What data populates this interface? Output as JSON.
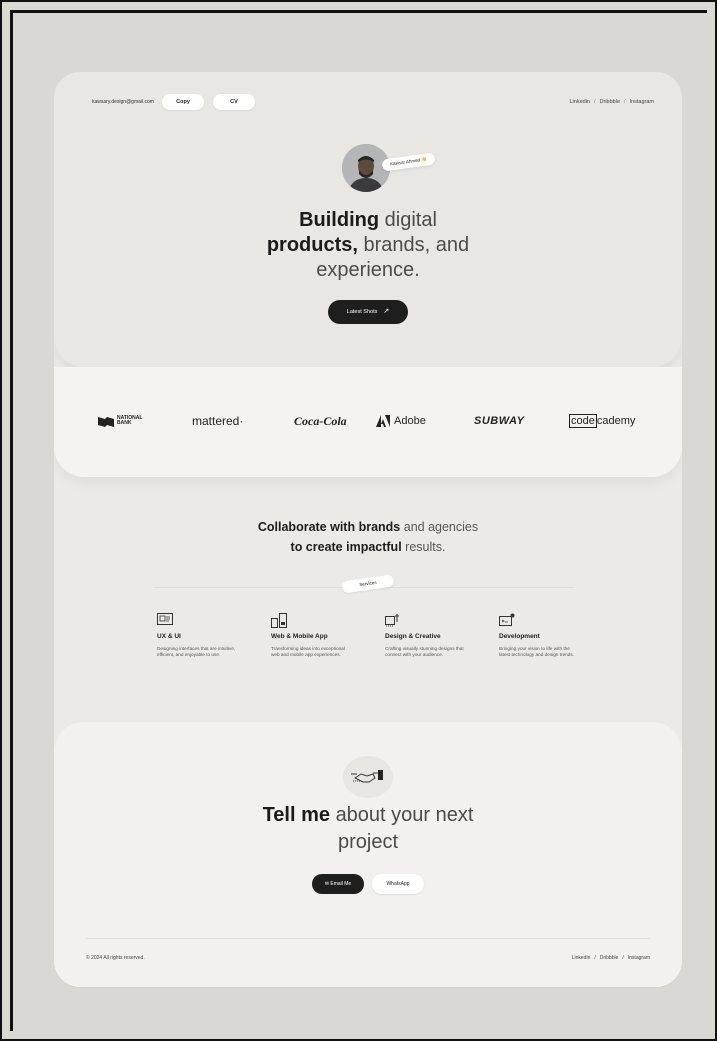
{
  "header": {
    "email": "kawsary.design@gmail.com",
    "copy_label": "Copy",
    "cv_label": "CV",
    "social": [
      "Linkedin",
      "Dribbble",
      "Instagram"
    ],
    "separator": "/"
  },
  "hero": {
    "name_tag": "Kawsar Ahmed 👋",
    "title_line1_bold": "Building",
    "title_line1_light": "digital",
    "title_line2_bold": "products,",
    "title_line2_light": "brands, and",
    "title_line3": "experience.",
    "cta_label": "Latest Shots",
    "cta_arrow": "↗"
  },
  "logos": {
    "national_bank_1": "NATIONAL",
    "national_bank_2": "BANK",
    "mattered": "mattered·",
    "cocacola": "Coca-Cola",
    "adobe": "Adobe",
    "subway": "SUBWAY",
    "codecademy_box": "code",
    "codecademy_rest": "cademy"
  },
  "services": {
    "headline_line1_bold": "Collaborate with brands",
    "headline_line1_light": "and agencies",
    "headline_line2_bold": "to create impactful",
    "headline_line2_light": "results.",
    "tag": "Services",
    "items": [
      {
        "title": "UX & UI",
        "desc": "Designing interfaces that are intuitive, efficient, and enjoyable to use.",
        "icon": "ux-ui-icon"
      },
      {
        "title": "Web & Mobile App",
        "desc": "Transforming ideas into exceptional web and mobile app experiences.",
        "icon": "devices-icon"
      },
      {
        "title": "Design & Creative",
        "desc": "Crafting visually stunning designs that connect with your audience.",
        "icon": "design-icon"
      },
      {
        "title": "Development",
        "desc": "Bringing your vision to life with the latest technology and design trends.",
        "icon": "development-icon"
      }
    ]
  },
  "cta": {
    "title_bold": "Tell me",
    "title_light": "about your next",
    "title_line2": "project",
    "email_label": "Email Me",
    "whatsapp_label": "WhatsApp"
  },
  "footer": {
    "copyright": "© 2024 All rights reserved.",
    "social": [
      "Linkedin",
      "Dribbble",
      "Instagram"
    ]
  },
  "colors": {
    "background": "#d9d8d3",
    "page": "#ebeae7",
    "dark": "#1e1e1e"
  }
}
